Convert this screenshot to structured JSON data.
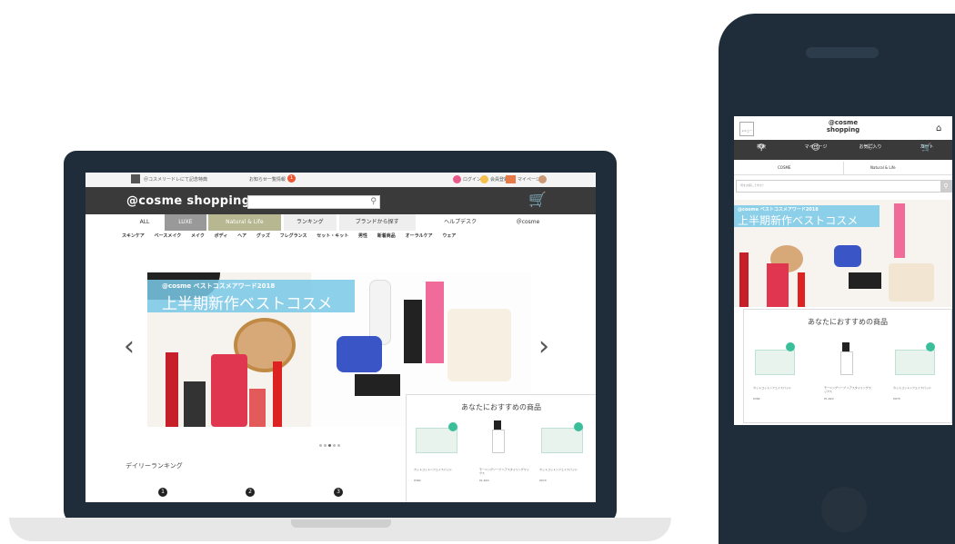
{
  "laptop": {
    "topbar": {
      "promo": "＠コスメリードレにて記念特典",
      "news": "お知らせ一覧情報",
      "news_badge": "1",
      "links": [
        "ログイン",
        "会員登録",
        "マイページ",
        "カート"
      ]
    },
    "logo": "@cosme shopping",
    "search_placeholder": "",
    "nav": [
      {
        "label": "ALL",
        "style": "plain"
      },
      {
        "label": "LUXE",
        "style": "gray"
      },
      {
        "label": "Natural & Life",
        "style": "olive"
      },
      {
        "label": "ランキング",
        "style": "light"
      },
      {
        "label": "ブランドから探す",
        "style": "light"
      },
      {
        "label": "ヘルプデスク",
        "style": "plain"
      },
      {
        "label": "＠cosme",
        "style": "plain"
      }
    ],
    "categories": [
      "スキンケア",
      "ベースメイク",
      "メイク",
      "ボディ",
      "ヘア",
      "グッズ",
      "フレグランス",
      "セット・キット",
      "男性",
      "新着商品",
      "オーラルケア",
      "ウェア"
    ],
    "banner": {
      "caption_small": "@cosme ベストコスメアワード2018",
      "caption_large": "上半期新作ベストコスメ",
      "prev_arrow": "‹",
      "next_arrow": "›"
    },
    "recommend": {
      "title": "あなたにおすすめの商品",
      "items": [
        {
          "name": "カットコットンフェイスパッド",
          "price": "¥382"
        },
        {
          "name": "モーニングソープ ヘアスタイリングワックス",
          "price": "¥1,620"
        },
        {
          "name": "カットコットンフェイスパッド",
          "price": "¥970"
        }
      ]
    },
    "ranking": {
      "title": "デイリーランキング",
      "badges": [
        "1",
        "2",
        "3"
      ]
    }
  },
  "phone": {
    "menu_label": "メニュー",
    "logo_line1": "@cosme",
    "logo_line2": "shopping",
    "icons": [
      {
        "label": "検索",
        "icon": "search-icon"
      },
      {
        "label": "マイページ",
        "icon": "user-icon"
      },
      {
        "label": "お気に入り",
        "icon": "heart-icon"
      },
      {
        "label": "カート",
        "icon": "cart-icon"
      }
    ],
    "tabs": [
      "COSME",
      "Natural & Life"
    ],
    "search_placeholder": "何をお探しですか？",
    "banner": {
      "caption_small": "@cosme ベストコスメアワード2018",
      "caption_large": "上半期新作ベストコスメ"
    },
    "recommend": {
      "title": "あなたにおすすめの商品",
      "items": [
        {
          "name": "カットコットンフェイスパッド",
          "price": "¥382"
        },
        {
          "name": "モーニングソープ ヘアスタイリングワックス",
          "price": "¥1,620"
        },
        {
          "name": "カットコットンフェイスパッド",
          "price": "¥970"
        }
      ]
    }
  },
  "colors": {
    "bezel": "#1f2d3a",
    "header": "#3a3a3a",
    "caption": "#78c8e6",
    "accent_green": "#3bbf9a"
  }
}
